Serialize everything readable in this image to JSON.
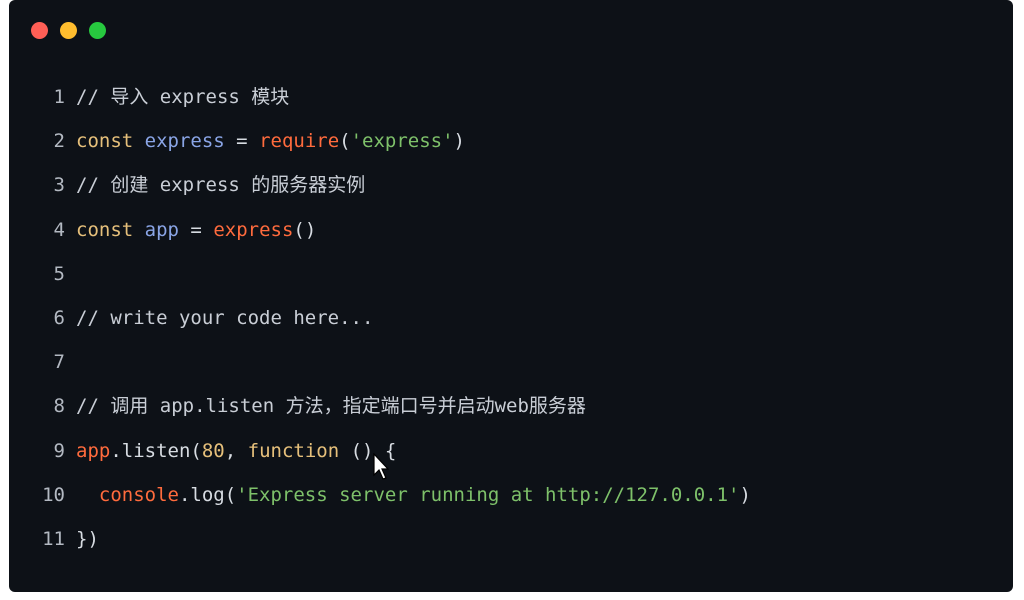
{
  "colors": {
    "background": "#0d1117",
    "comment": "#c9ced6",
    "keyword": "#e6c07b",
    "identifier": "#8aa5e6",
    "function": "#ff6b3d",
    "string": "#7ec16a",
    "number": "#e6c07b",
    "punct": "#d7dce2",
    "dot_red": "#ff5f56",
    "dot_yellow": "#ffbd2e",
    "dot_green": "#27c93f"
  },
  "window_controls": [
    {
      "name": "close",
      "color": "#ff5f56"
    },
    {
      "name": "minimize",
      "color": "#ffbd2e"
    },
    {
      "name": "maximize",
      "color": "#27c93f"
    }
  ],
  "code": {
    "lines": [
      {
        "n": "1",
        "tokens": [
          {
            "t": "// 导入 express 模块",
            "c": "comment"
          }
        ]
      },
      {
        "n": "2",
        "tokens": [
          {
            "t": "const",
            "c": "keyword"
          },
          {
            "t": " ",
            "c": "punct"
          },
          {
            "t": "express",
            "c": "identifier"
          },
          {
            "t": " = ",
            "c": "punct"
          },
          {
            "t": "require",
            "c": "function"
          },
          {
            "t": "(",
            "c": "punct"
          },
          {
            "t": "'express'",
            "c": "string"
          },
          {
            "t": ")",
            "c": "punct"
          }
        ]
      },
      {
        "n": "3",
        "tokens": [
          {
            "t": "// 创建 express 的服务器实例",
            "c": "comment"
          }
        ]
      },
      {
        "n": "4",
        "tokens": [
          {
            "t": "const",
            "c": "keyword"
          },
          {
            "t": " ",
            "c": "punct"
          },
          {
            "t": "app",
            "c": "identifier"
          },
          {
            "t": " = ",
            "c": "punct"
          },
          {
            "t": "express",
            "c": "function"
          },
          {
            "t": "()",
            "c": "punct"
          }
        ]
      },
      {
        "n": "5",
        "tokens": []
      },
      {
        "n": "6",
        "tokens": [
          {
            "t": "// write your code here...",
            "c": "comment"
          }
        ]
      },
      {
        "n": "7",
        "tokens": []
      },
      {
        "n": "8",
        "tokens": [
          {
            "t": "// 调用 app.listen 方法，指定端口号并启动web服务器",
            "c": "comment"
          }
        ]
      },
      {
        "n": "9",
        "tokens": [
          {
            "t": "app",
            "c": "function"
          },
          {
            "t": ".listen(",
            "c": "punct"
          },
          {
            "t": "80",
            "c": "number"
          },
          {
            "t": ", ",
            "c": "punct"
          },
          {
            "t": "function",
            "c": "keyword"
          },
          {
            "t": " () {",
            "c": "punct"
          }
        ]
      },
      {
        "n": "10",
        "tokens": [
          {
            "t": "  ",
            "c": "punct"
          },
          {
            "t": "console",
            "c": "function"
          },
          {
            "t": ".log(",
            "c": "punct"
          },
          {
            "t": "'Express server running at http://127.0.0.1'",
            "c": "string"
          },
          {
            "t": ")",
            "c": "punct"
          }
        ]
      },
      {
        "n": "11",
        "tokens": [
          {
            "t": "})",
            "c": "punct"
          }
        ]
      }
    ]
  },
  "cursor_icon": "arrow-pointer-icon"
}
